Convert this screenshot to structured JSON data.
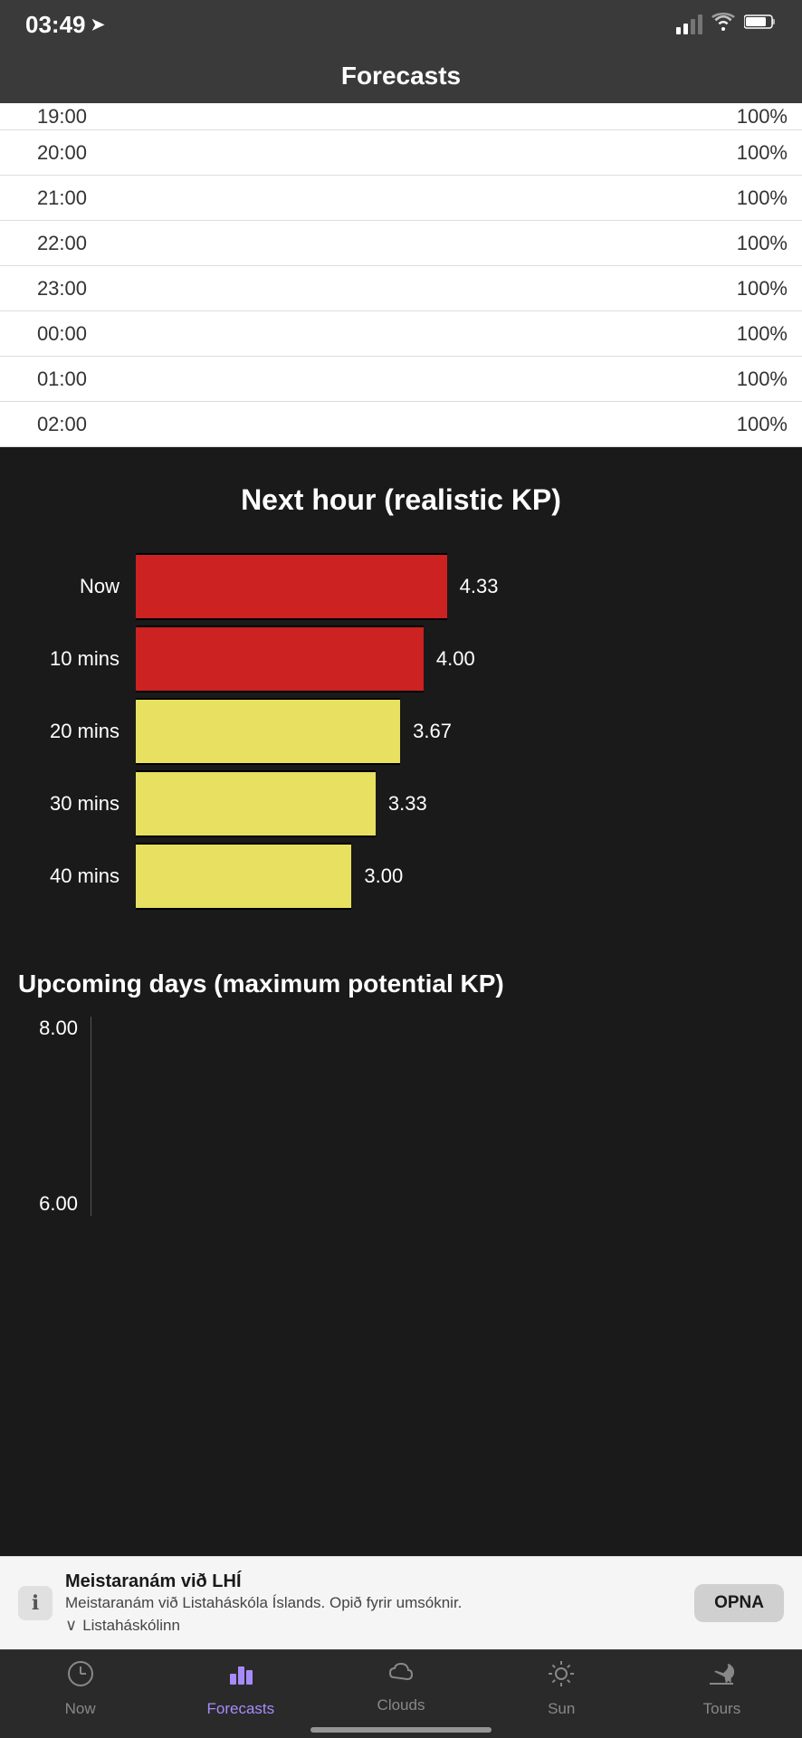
{
  "statusBar": {
    "time": "03:49",
    "arrow": "➤",
    "signal": [
      40,
      60,
      80,
      100
    ],
    "wifi": "wifi",
    "battery": "battery"
  },
  "header": {
    "title": "Forecasts"
  },
  "hourChart": {
    "rows": [
      {
        "time": "19:00",
        "pct": "100%"
      },
      {
        "time": "20:00",
        "pct": "100%"
      },
      {
        "time": "21:00",
        "pct": "100%"
      },
      {
        "time": "22:00",
        "pct": "100%"
      },
      {
        "time": "23:00",
        "pct": "100%"
      },
      {
        "time": "00:00",
        "pct": "100%"
      },
      {
        "time": "01:00",
        "pct": "100%"
      },
      {
        "time": "02:00",
        "pct": "100%"
      }
    ]
  },
  "kpSection": {
    "title": "Next hour (realistic KP)",
    "bars": [
      {
        "label": "Now",
        "value": 4.33,
        "maxValue": 9,
        "color": "#cc2222"
      },
      {
        "label": "10 mins",
        "value": 4.0,
        "maxValue": 9,
        "color": "#cc2222"
      },
      {
        "label": "20 mins",
        "value": 3.67,
        "maxValue": 9,
        "color": "#e8e060"
      },
      {
        "label": "30 mins",
        "value": 3.33,
        "maxValue": 9,
        "color": "#e8e060"
      },
      {
        "label": "40 mins",
        "value": 3.0,
        "maxValue": 9,
        "color": "#e8e060"
      }
    ]
  },
  "upcomingSection": {
    "title": "Upcoming days (maximum potential KP)",
    "yLabels": [
      "8.00",
      "6.00"
    ]
  },
  "banner": {
    "icon": "ℹ",
    "title": "Meistaranám við LHÍ",
    "subtitle": "Meistaranám við Listaháskóla Íslands. Opið fyrir umsóknir.",
    "expand": "∨",
    "expandLabel": "Listaháskólinn",
    "buttonLabel": "OPNA"
  },
  "tabBar": {
    "tabs": [
      {
        "id": "now",
        "icon": "🕐",
        "label": "Now",
        "active": false
      },
      {
        "id": "forecasts",
        "icon": "📊",
        "label": "Forecasts",
        "active": true
      },
      {
        "id": "clouds",
        "icon": "☁",
        "label": "Clouds",
        "active": false
      },
      {
        "id": "sun",
        "icon": "☀",
        "label": "Sun",
        "active": false
      },
      {
        "id": "tours",
        "icon": "✈",
        "label": "Tours",
        "active": false
      }
    ]
  }
}
